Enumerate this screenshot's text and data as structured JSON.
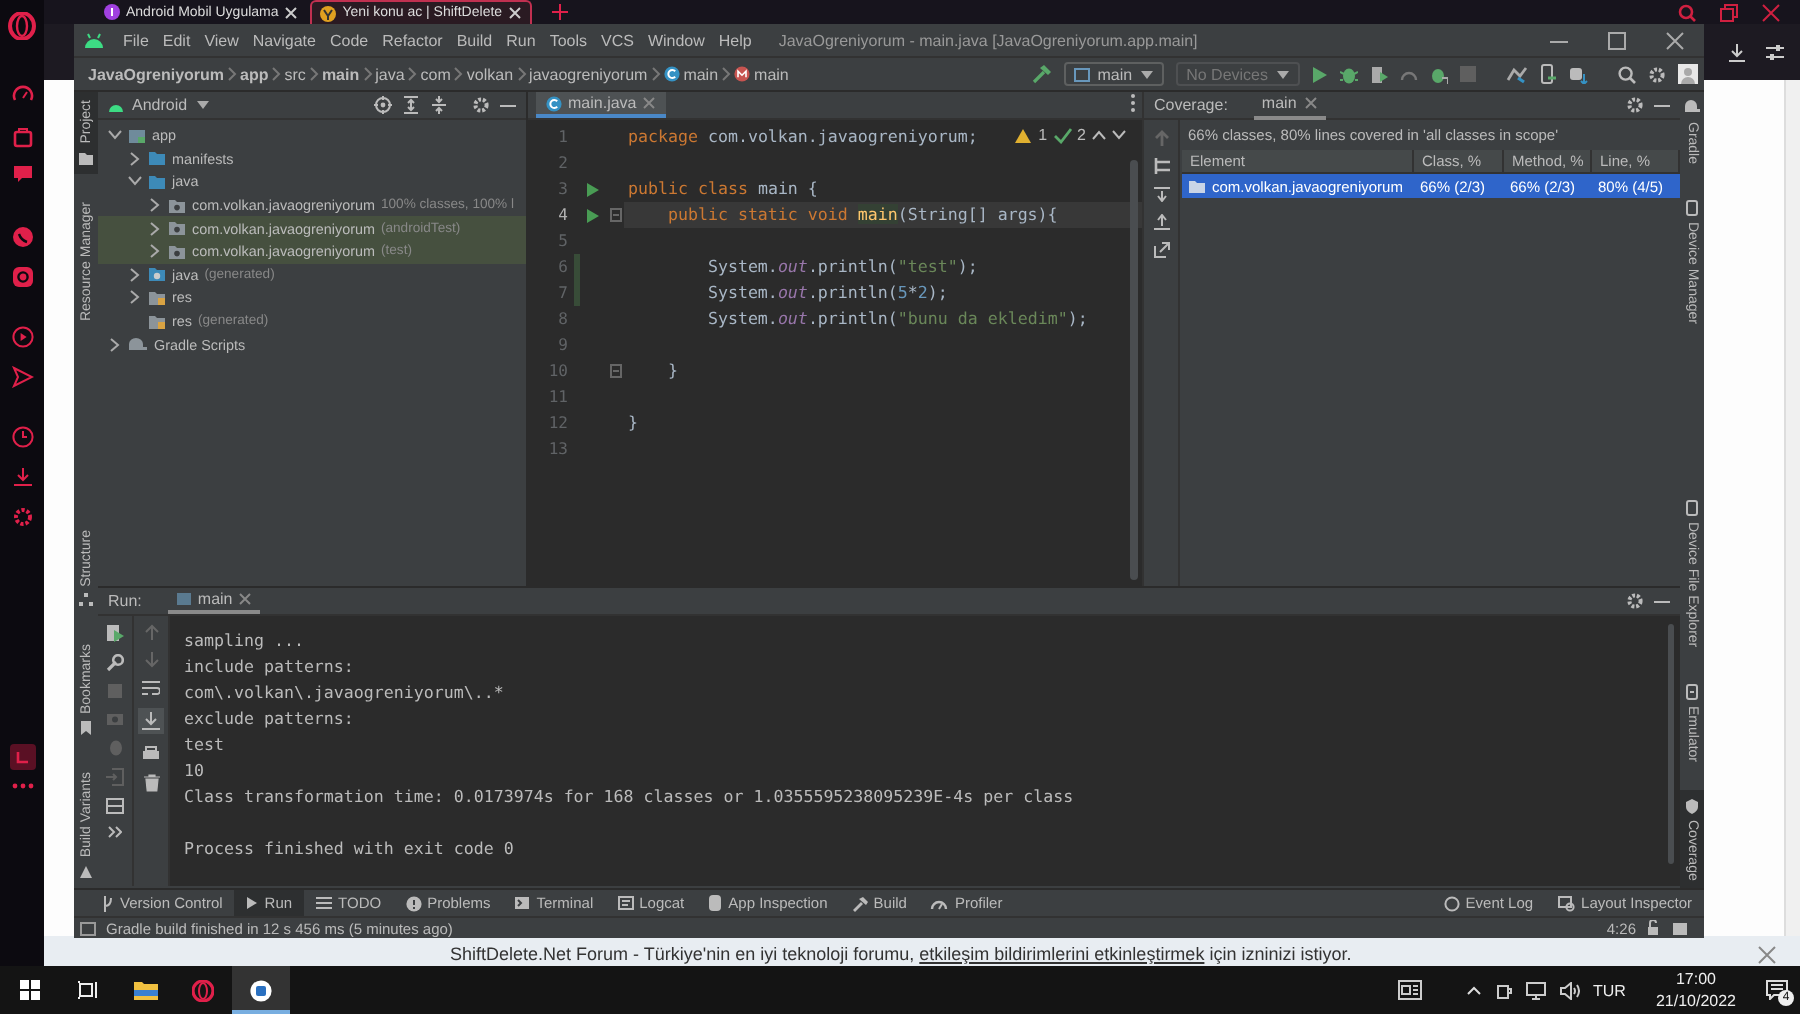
{
  "browser": {
    "tabs": [
      {
        "title": "Android Mobil Uygulama",
        "selected": false
      },
      {
        "title": "Yeni konu ac | ShiftDelete",
        "selected": true
      }
    ],
    "notification": {
      "before": "ShiftDelete.Net Forum - Türkiye'nin en iyi teknoloji forumu, ",
      "link": "etkileşim bildirimlerini etkinleştirmek",
      "after": " için izninizi istiyor."
    }
  },
  "ide": {
    "title_bar": {
      "menus": [
        "File",
        "Edit",
        "View",
        "Navigate",
        "Code",
        "Refactor",
        "Build",
        "Run",
        "Tools",
        "VCS",
        "Window",
        "Help"
      ],
      "title": "JavaOgreniyorum - main.java [JavaOgreniyorum.app.main]"
    },
    "nav_bar": {
      "breadcrumbs": [
        {
          "label": "JavaOgreniyorum",
          "kind": "strong"
        },
        {
          "label": "app",
          "kind": "strong"
        },
        {
          "label": "src",
          "kind": "plain"
        },
        {
          "label": "main",
          "kind": "strong"
        },
        {
          "label": "java",
          "kind": "plain"
        },
        {
          "label": "com",
          "kind": "plain"
        },
        {
          "label": "volkan",
          "kind": "plain"
        },
        {
          "label": "javaogreniyorum",
          "kind": "plain"
        },
        {
          "label": "main",
          "kind": "class"
        },
        {
          "label": "main",
          "kind": "method"
        }
      ],
      "run_config": "main",
      "device": "No Devices"
    },
    "left_tool_windows": [
      {
        "label": "Project",
        "selected": true
      },
      {
        "label": "Resource Manager",
        "selected": false
      }
    ],
    "left_bottom_tool_windows": [
      {
        "label": "Structure",
        "selected": false
      },
      {
        "label": "Bookmarks",
        "selected": false
      },
      {
        "label": "Build Variants",
        "selected": false
      }
    ],
    "project": {
      "view": "Android",
      "tree": [
        {
          "label": "app",
          "kind": "module",
          "expandable": true,
          "expanded": true,
          "highlighted": false,
          "children": [
            {
              "label": "manifests",
              "kind": "folder",
              "expandable": true,
              "expanded": false,
              "highlighted": false
            },
            {
              "label": "java",
              "kind": "folder",
              "expandable": true,
              "expanded": true,
              "highlighted": false,
              "children": [
                {
                  "label": "com.volkan.javaogreniyorum",
                  "note": "100% classes, 100% l",
                  "kind": "package",
                  "expandable": true,
                  "expanded": false,
                  "highlighted": false
                },
                {
                  "label": "com.volkan.javaogreniyorum",
                  "note": "(androidTest)",
                  "kind": "package",
                  "expandable": true,
                  "expanded": false,
                  "highlighted": true
                },
                {
                  "label": "com.volkan.javaogreniyorum",
                  "note": "(test)",
                  "kind": "package",
                  "expandable": true,
                  "expanded": false,
                  "highlighted": true
                }
              ]
            },
            {
              "label": "java",
              "note": "(generated)",
              "kind": "generated",
              "expandable": true,
              "expanded": false,
              "highlighted": false
            },
            {
              "label": "res",
              "kind": "res",
              "expandable": true,
              "expanded": false,
              "highlighted": false
            },
            {
              "label": "res",
              "note": "(generated)",
              "kind": "res",
              "expandable": false,
              "highlighted": false
            }
          ]
        },
        {
          "label": "Gradle Scripts",
          "kind": "gradle",
          "expandable": true,
          "expanded": false,
          "highlighted": false
        }
      ]
    },
    "editor": {
      "tab": "main.java",
      "warnings": "1",
      "checks": "2",
      "lines": [
        {
          "number": "1",
          "current": false,
          "tokens": [
            {
              "kind": "kw",
              "text": "package"
            },
            {
              "kind": "plain",
              "text": " com.volkan.javaogreniyorum;"
            }
          ]
        },
        {
          "number": "2",
          "current": false
        },
        {
          "number": "3",
          "run": true,
          "current": false,
          "tokens": [
            {
              "kind": "kw",
              "text": "public class"
            },
            {
              "kind": "plain",
              "text": " main {"
            }
          ]
        },
        {
          "number": "4",
          "run": true,
          "current": true,
          "fold": true,
          "tokens": [
            {
              "kind": "kw",
              "text": "    public static void "
            },
            {
              "kind": "decl",
              "text": "main"
            },
            {
              "kind": "plain",
              "text": "(String[] args){"
            }
          ]
        },
        {
          "number": "5",
          "current": false
        },
        {
          "number": "6",
          "changed": true,
          "current": false,
          "tokens": [
            {
              "kind": "plain",
              "text": "        System."
            },
            {
              "kind": "field",
              "text": "out"
            },
            {
              "kind": "plain",
              "text": ".println("
            },
            {
              "kind": "str",
              "text": "\"test\""
            },
            {
              "kind": "plain",
              "text": ");"
            }
          ]
        },
        {
          "number": "7",
          "changed": true,
          "current": false,
          "tokens": [
            {
              "kind": "plain",
              "text": "        System."
            },
            {
              "kind": "field",
              "text": "out"
            },
            {
              "kind": "plain",
              "text": ".println("
            },
            {
              "kind": "num",
              "text": "5"
            },
            {
              "kind": "plain",
              "text": "*"
            },
            {
              "kind": "num",
              "text": "2"
            },
            {
              "kind": "plain",
              "text": ");"
            }
          ]
        },
        {
          "number": "8",
          "current": false,
          "tokens": [
            {
              "kind": "plain",
              "text": "        System."
            },
            {
              "kind": "field",
              "text": "out"
            },
            {
              "kind": "plain",
              "text": ".println("
            },
            {
              "kind": "str",
              "text": "\"bunu da ekledim\""
            },
            {
              "kind": "plain",
              "text": ");"
            }
          ]
        },
        {
          "number": "9",
          "current": false
        },
        {
          "number": "10",
          "current": false,
          "fold": true,
          "tokens": [
            {
              "kind": "plain",
              "text": "    }"
            }
          ]
        },
        {
          "number": "11",
          "current": false
        },
        {
          "number": "12",
          "current": false,
          "tokens": [
            {
              "kind": "plain",
              "text": "}"
            }
          ]
        },
        {
          "number": "13",
          "current": false
        }
      ]
    },
    "coverage": {
      "label": "Coverage:",
      "tab": "main",
      "summary": "66% classes, 80% lines covered in 'all classes in scope'",
      "columns": [
        "Element",
        "Class, %",
        "Method, %",
        "Line, %"
      ],
      "rows": [
        {
          "selected": true,
          "cells": [
            "com.volkan.javaogreniyorum",
            "66% (2/3)",
            "66% (2/3)",
            "80% (4/5)"
          ]
        }
      ]
    },
    "right_tool_windows": [
      {
        "label": "Gradle",
        "selected": false
      },
      {
        "label": "Device Manager",
        "selected": false
      }
    ],
    "right_bottom_tool_windows": [
      {
        "label": "Device File Explorer",
        "selected": false
      },
      {
        "label": "Emulator",
        "selected": false
      },
      {
        "label": "Coverage",
        "selected": true
      }
    ],
    "run": {
      "label": "Run:",
      "tab": "main",
      "console": [
        {
          "kind": "output",
          "text": "sampling ..."
        },
        {
          "kind": "output",
          "text": "include patterns:"
        },
        {
          "kind": "output",
          "text": "com\\.volkan\\.javaogreniyorum\\..*"
        },
        {
          "kind": "output",
          "text": "exclude patterns:"
        },
        {
          "kind": "output",
          "text": "test"
        },
        {
          "kind": "output",
          "text": "10"
        },
        {
          "kind": "output",
          "text": "Class transformation time: 0.0173974s for 168 classes or 1.0355595238095239E-4s per class"
        },
        {
          "kind": "exit",
          "text": "Process finished with exit code 0"
        }
      ]
    },
    "tool_tabs": [
      {
        "label": "Version Control",
        "selected": false
      },
      {
        "label": "Run",
        "selected": true
      },
      {
        "label": "TODO",
        "selected": false
      },
      {
        "label": "Problems",
        "selected": false
      },
      {
        "label": "Terminal",
        "selected": false
      },
      {
        "label": "Logcat",
        "selected": false
      },
      {
        "label": "App Inspection",
        "selected": false
      },
      {
        "label": "Build",
        "selected": false
      },
      {
        "label": "Profiler",
        "selected": false
      }
    ],
    "right_tool_tabs": [
      {
        "label": "Event Log",
        "selected": false
      },
      {
        "label": "Layout Inspector",
        "selected": false
      }
    ],
    "status_bar": {
      "message": "Gradle build finished in 12 s 456 ms (5 minutes ago)",
      "position": "4:26"
    }
  },
  "taskbar": {
    "language": "TUR",
    "time": "17:00",
    "date": "21/10/2022",
    "notifications": "4"
  }
}
